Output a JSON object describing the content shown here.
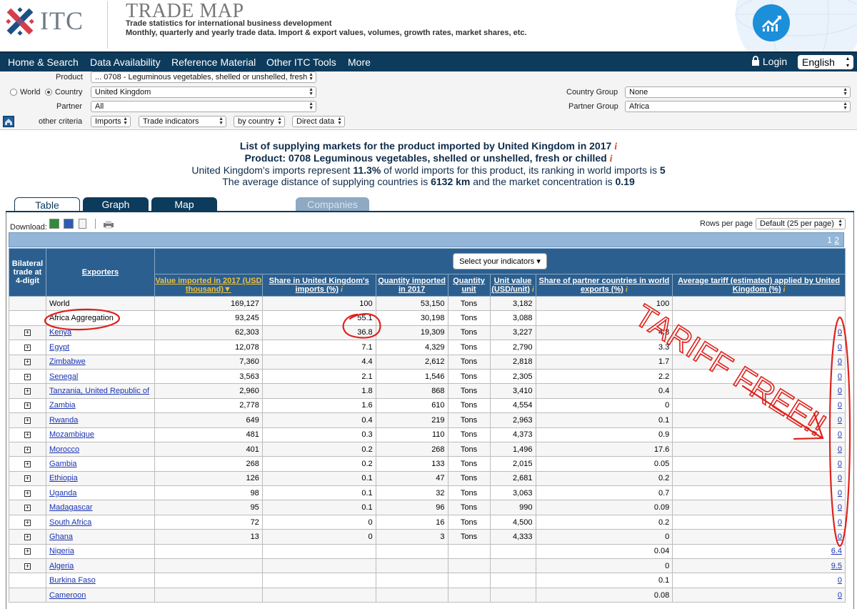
{
  "header": {
    "logo_text": "ITC",
    "title": "TRADE MAP",
    "subtitle1": "Trade statistics for international business development",
    "subtitle2": "Monthly, quarterly and yearly trade data. Import & export values, volumes, growth rates, market shares, etc."
  },
  "nav": {
    "items": [
      "Home & Search",
      "Data Availability",
      "Reference Material",
      "Other ITC Tools",
      "More"
    ],
    "login": "Login",
    "language": "English"
  },
  "criteria": {
    "product_label": "Product",
    "product_value": "... 0708 - Leguminous vegetables, shelled or unshelled, fresh",
    "world_label": "World",
    "country_label": "Country",
    "country_value": "United Kingdom",
    "partner_label": "Partner",
    "partner_value": "All",
    "country_group_label": "Country Group",
    "country_group_value": "None",
    "partner_group_label": "Partner Group",
    "partner_group_value": "Africa",
    "other_label": "other criteria",
    "flow_value": "Imports",
    "indicator_value": "Trade indicators",
    "by_value": "by country",
    "data_value": "Direct data"
  },
  "title": {
    "line1": "List of supplying markets for the product imported by United Kingdom in 2017",
    "line2": "Product: 0708 Leguminous vegetables, shelled or unshelled, fresh or chilled",
    "line3_a": "United Kingdom's imports represent ",
    "line3_b": "11.3%",
    "line3_c": " of world imports for this product, its ranking in world imports is ",
    "line3_d": "5",
    "line4_a": "The average distance of supplying countries is ",
    "line4_b": "6132 km",
    "line4_c": " and the market concentration is ",
    "line4_d": "0.19",
    "info": "i"
  },
  "tabs": {
    "table": "Table",
    "graph": "Graph",
    "map": "Map",
    "companies": "Companies"
  },
  "toolbar": {
    "download": "Download:",
    "rows_per_page_label": "Rows per page",
    "rows_per_page_value": "Default (25 per page)",
    "page1": "1",
    "page2": "2"
  },
  "table": {
    "col_bilateral": "Bilateral trade at 4-digit",
    "col_exporters": "Exporters",
    "select_indicators": "Select your indicators",
    "col_value": "Value imported in 2017 (USD thousand)",
    "col_share": "Share in United Kingdom's imports (%)",
    "col_qty": "Quantity imported in 2017",
    "col_qty_unit": "Quantity unit",
    "col_unit_value": "Unit value (USD/unit)",
    "col_share_partner": "Share of partner countries in world exports (%)",
    "col_tariff": "Average tariff (estimated) applied by United Kingdom (%)",
    "rows": [
      {
        "plus": false,
        "link": false,
        "name": "World",
        "value": "169,127",
        "share": "100",
        "qty": "53,150",
        "unit": "Tons",
        "uv": "3,182",
        "sp": "100",
        "tariff": ""
      },
      {
        "plus": false,
        "link": false,
        "name": "Africa Aggregation",
        "value": "93,245",
        "share": "55.1",
        "qty": "30,198",
        "unit": "Tons",
        "uv": "3,088",
        "sp": "",
        "tariff": ""
      },
      {
        "plus": true,
        "link": true,
        "name": "Kenya",
        "value": "62,303",
        "share": "36.8",
        "qty": "19,309",
        "unit": "Tons",
        "uv": "3,227",
        "sp": "4.8",
        "tariff": "0"
      },
      {
        "plus": true,
        "link": true,
        "name": "Egypt",
        "value": "12,078",
        "share": "7.1",
        "qty": "4,329",
        "unit": "Tons",
        "uv": "2,790",
        "sp": "3.3",
        "tariff": "0"
      },
      {
        "plus": true,
        "link": true,
        "name": "Zimbabwe",
        "value": "7,360",
        "share": "4.4",
        "qty": "2,612",
        "unit": "Tons",
        "uv": "2,818",
        "sp": "1.7",
        "tariff": "0"
      },
      {
        "plus": true,
        "link": true,
        "name": "Senegal",
        "value": "3,563",
        "share": "2.1",
        "qty": "1,546",
        "unit": "Tons",
        "uv": "2,305",
        "sp": "2.2",
        "tariff": "0"
      },
      {
        "plus": true,
        "link": true,
        "name": "Tanzania, United Republic of",
        "value": "2,960",
        "share": "1.8",
        "qty": "868",
        "unit": "Tons",
        "uv": "3,410",
        "sp": "0.4",
        "tariff": "0"
      },
      {
        "plus": true,
        "link": true,
        "name": "Zambia",
        "value": "2,778",
        "share": "1.6",
        "qty": "610",
        "unit": "Tons",
        "uv": "4,554",
        "sp": "0",
        "tariff": "0"
      },
      {
        "plus": true,
        "link": true,
        "name": "Rwanda",
        "value": "649",
        "share": "0.4",
        "qty": "219",
        "unit": "Tons",
        "uv": "2,963",
        "sp": "0.1",
        "tariff": "0"
      },
      {
        "plus": true,
        "link": true,
        "name": "Mozambique",
        "value": "481",
        "share": "0.3",
        "qty": "110",
        "unit": "Tons",
        "uv": "4,373",
        "sp": "0.9",
        "tariff": "0"
      },
      {
        "plus": true,
        "link": true,
        "name": "Morocco",
        "value": "401",
        "share": "0.2",
        "qty": "268",
        "unit": "Tons",
        "uv": "1,496",
        "sp": "17.6",
        "tariff": "0"
      },
      {
        "plus": true,
        "link": true,
        "name": "Gambia",
        "value": "268",
        "share": "0.2",
        "qty": "133",
        "unit": "Tons",
        "uv": "2,015",
        "sp": "0.05",
        "tariff": "0"
      },
      {
        "plus": true,
        "link": true,
        "name": "Ethiopia",
        "value": "126",
        "share": "0.1",
        "qty": "47",
        "unit": "Tons",
        "uv": "2,681",
        "sp": "0.2",
        "tariff": "0"
      },
      {
        "plus": true,
        "link": true,
        "name": "Uganda",
        "value": "98",
        "share": "0.1",
        "qty": "32",
        "unit": "Tons",
        "uv": "3,063",
        "sp": "0.7",
        "tariff": "0"
      },
      {
        "plus": true,
        "link": true,
        "name": "Madagascar",
        "value": "95",
        "share": "0.1",
        "qty": "96",
        "unit": "Tons",
        "uv": "990",
        "sp": "0.09",
        "tariff": "0"
      },
      {
        "plus": true,
        "link": true,
        "name": "South Africa",
        "value": "72",
        "share": "0",
        "qty": "16",
        "unit": "Tons",
        "uv": "4,500",
        "sp": "0.2",
        "tariff": "0"
      },
      {
        "plus": true,
        "link": true,
        "name": "Ghana",
        "value": "13",
        "share": "0",
        "qty": "3",
        "unit": "Tons",
        "uv": "4,333",
        "sp": "0",
        "tariff": "0"
      },
      {
        "plus": true,
        "link": true,
        "name": "Nigeria",
        "value": "",
        "share": "",
        "qty": "",
        "unit": "",
        "uv": "",
        "sp": "0.04",
        "tariff": "6.4"
      },
      {
        "plus": true,
        "link": true,
        "name": "Algeria",
        "value": "",
        "share": "",
        "qty": "",
        "unit": "",
        "uv": "",
        "sp": "0",
        "tariff": "9.5"
      },
      {
        "plus": false,
        "link": true,
        "name": "Burkina Faso",
        "value": "",
        "share": "",
        "qty": "",
        "unit": "",
        "uv": "",
        "sp": "0.1",
        "tariff": "0"
      },
      {
        "plus": false,
        "link": true,
        "name": "Cameroon",
        "value": "",
        "share": "",
        "qty": "",
        "unit": "",
        "uv": "",
        "sp": "0.08",
        "tariff": "0"
      }
    ]
  },
  "annotation": {
    "text": "TARIFF FREE!!",
    "color": "#e0211b"
  },
  "colors": {
    "nav_bg": "#0d3b5c",
    "header_th": "#2b5f8f",
    "page_bar": "#93b6d9",
    "sorted_col": "#f2c13a"
  }
}
